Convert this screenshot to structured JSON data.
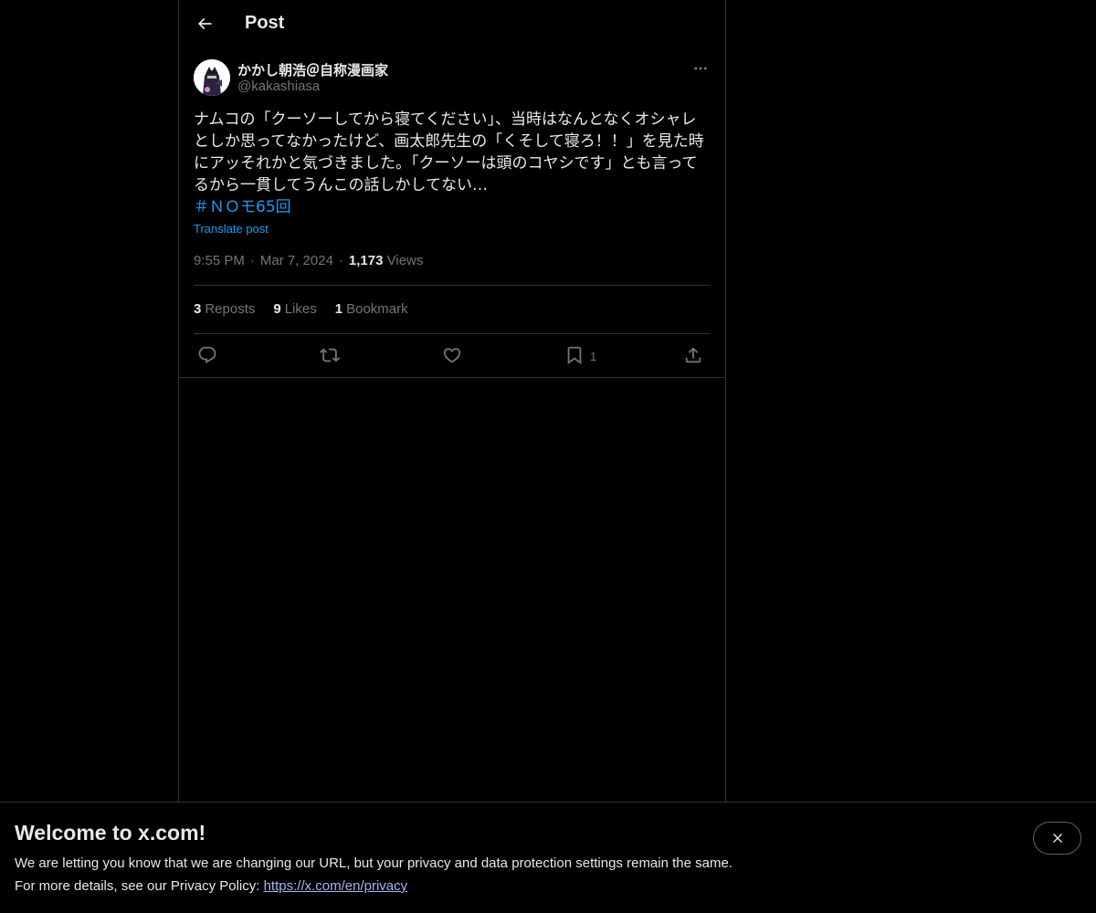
{
  "header": {
    "title": "Post"
  },
  "author": {
    "name": "かかし朝浩＠自称漫画家",
    "handle": "@kakashiasa"
  },
  "tweet": {
    "lines": [
      "ナムコの「クーソーしてから寝てください」、当時はなんとなくオシャレ",
      "としか思ってなかったけど、画太郎先生の「くそして寝ろ！！」を見た時",
      "にアッそれかと気づきました。「クーソーは頭のコヤシです」とも言って",
      "るから一貫してうんこの話しかしてない…"
    ],
    "hashtag": "＃ＮＯモ65回",
    "translate_label": "Translate post"
  },
  "meta": {
    "time": "9:55 PM",
    "date": "Mar 7, 2024",
    "views_count": "1,173",
    "views_label": "Views"
  },
  "stats": {
    "reposts_count": "3",
    "reposts_label": "Reposts",
    "likes_count": "9",
    "likes_label": "Likes",
    "bookmarks_count": "1",
    "bookmarks_label": "Bookmark"
  },
  "actions": {
    "bookmark_count": "1"
  },
  "banner": {
    "title": "Welcome to x.com!",
    "text1": "We are letting you know that we are changing our URL, but your privacy and data protection settings remain the same.",
    "text2_prefix": "For more details, see our Privacy Policy: ",
    "link": "https://x.com/en/privacy"
  },
  "colors": {
    "accent": "#1d9bf0",
    "background": "#000000",
    "text": "#e7e9ea",
    "muted": "#71767b",
    "border": "#2f3336",
    "link": "#a6b4f7"
  },
  "icons": [
    "back-arrow-icon",
    "more-icon",
    "reply-icon",
    "repost-icon",
    "like-icon",
    "bookmark-icon",
    "share-icon",
    "close-icon"
  ]
}
